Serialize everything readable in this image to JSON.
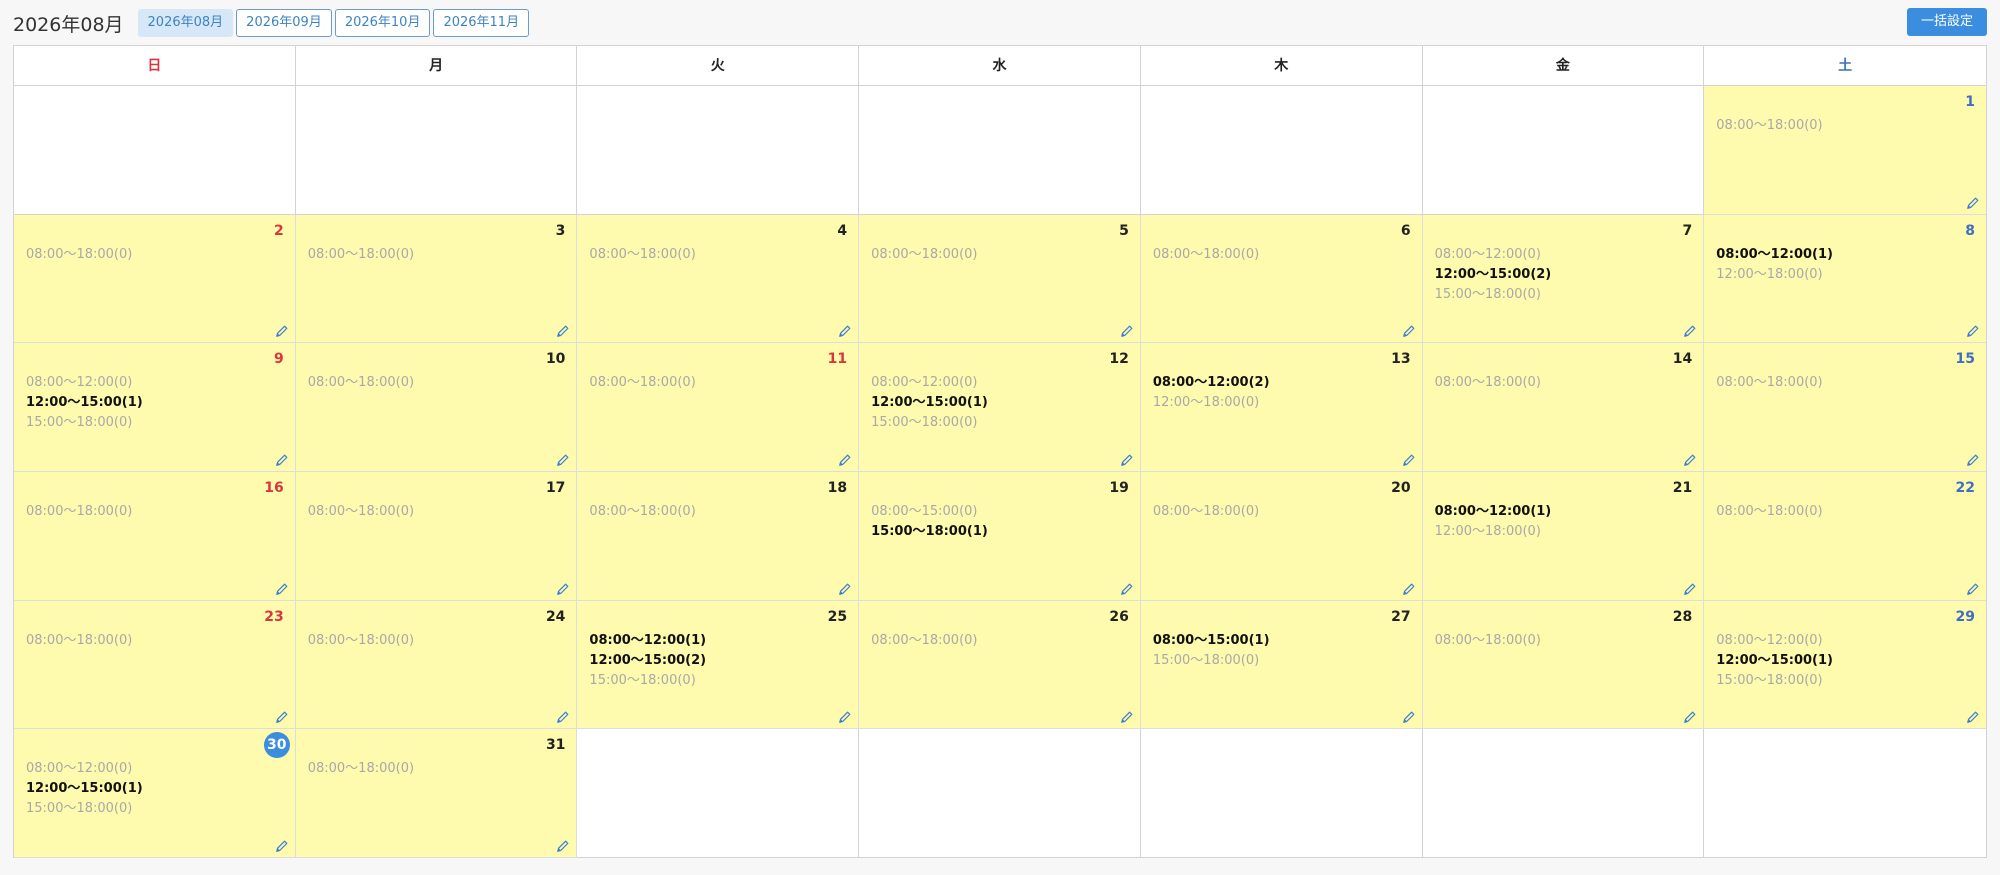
{
  "header": {
    "title": "2026年08月",
    "tabs": [
      {
        "label": "2026年08月",
        "active": true
      },
      {
        "label": "2026年09月",
        "active": false
      },
      {
        "label": "2026年10月",
        "active": false
      },
      {
        "label": "2026年11月",
        "active": false
      }
    ],
    "bulk_button": "一括設定"
  },
  "weekdays": [
    "日",
    "月",
    "火",
    "水",
    "木",
    "金",
    "土"
  ],
  "colors": {
    "sunday_holiday": "#d9363e",
    "saturday": "#3d6fc4",
    "active_day_bg": "#fffbae",
    "primary": "#3b8de0"
  },
  "icons": {
    "edit": "pencil-icon"
  },
  "days": [
    {
      "day": 1,
      "slots": [
        {
          "t": "08:00〜18:00(0)",
          "b": false
        }
      ]
    },
    {
      "day": 2,
      "slots": [
        {
          "t": "08:00〜18:00(0)",
          "b": false
        }
      ]
    },
    {
      "day": 3,
      "slots": [
        {
          "t": "08:00〜18:00(0)",
          "b": false
        }
      ]
    },
    {
      "day": 4,
      "slots": [
        {
          "t": "08:00〜18:00(0)",
          "b": false
        }
      ]
    },
    {
      "day": 5,
      "slots": [
        {
          "t": "08:00〜18:00(0)",
          "b": false
        }
      ]
    },
    {
      "day": 6,
      "slots": [
        {
          "t": "08:00〜18:00(0)",
          "b": false
        }
      ]
    },
    {
      "day": 7,
      "slots": [
        {
          "t": "08:00〜12:00(0)",
          "b": false
        },
        {
          "t": "12:00〜15:00(2)",
          "b": true
        },
        {
          "t": "15:00〜18:00(0)",
          "b": false
        }
      ]
    },
    {
      "day": 8,
      "slots": [
        {
          "t": "08:00〜12:00(1)",
          "b": true
        },
        {
          "t": "12:00〜18:00(0)",
          "b": false
        }
      ]
    },
    {
      "day": 9,
      "slots": [
        {
          "t": "08:00〜12:00(0)",
          "b": false
        },
        {
          "t": "12:00〜15:00(1)",
          "b": true
        },
        {
          "t": "15:00〜18:00(0)",
          "b": false
        }
      ]
    },
    {
      "day": 10,
      "slots": [
        {
          "t": "08:00〜18:00(0)",
          "b": false
        }
      ]
    },
    {
      "day": 11,
      "holiday": true,
      "slots": [
        {
          "t": "08:00〜18:00(0)",
          "b": false
        }
      ]
    },
    {
      "day": 12,
      "slots": [
        {
          "t": "08:00〜12:00(0)",
          "b": false
        },
        {
          "t": "12:00〜15:00(1)",
          "b": true
        },
        {
          "t": "15:00〜18:00(0)",
          "b": false
        }
      ]
    },
    {
      "day": 13,
      "slots": [
        {
          "t": "08:00〜12:00(2)",
          "b": true
        },
        {
          "t": "12:00〜18:00(0)",
          "b": false
        }
      ]
    },
    {
      "day": 14,
      "slots": [
        {
          "t": "08:00〜18:00(0)",
          "b": false
        }
      ]
    },
    {
      "day": 15,
      "slots": [
        {
          "t": "08:00〜18:00(0)",
          "b": false
        }
      ]
    },
    {
      "day": 16,
      "slots": [
        {
          "t": "08:00〜18:00(0)",
          "b": false
        }
      ]
    },
    {
      "day": 17,
      "slots": [
        {
          "t": "08:00〜18:00(0)",
          "b": false
        }
      ]
    },
    {
      "day": 18,
      "slots": [
        {
          "t": "08:00〜18:00(0)",
          "b": false
        }
      ]
    },
    {
      "day": 19,
      "slots": [
        {
          "t": "08:00〜15:00(0)",
          "b": false
        },
        {
          "t": "15:00〜18:00(1)",
          "b": true
        }
      ]
    },
    {
      "day": 20,
      "slots": [
        {
          "t": "08:00〜18:00(0)",
          "b": false
        }
      ]
    },
    {
      "day": 21,
      "slots": [
        {
          "t": "08:00〜12:00(1)",
          "b": true
        },
        {
          "t": "12:00〜18:00(0)",
          "b": false
        }
      ]
    },
    {
      "day": 22,
      "slots": [
        {
          "t": "08:00〜18:00(0)",
          "b": false
        }
      ]
    },
    {
      "day": 23,
      "slots": [
        {
          "t": "08:00〜18:00(0)",
          "b": false
        }
      ]
    },
    {
      "day": 24,
      "slots": [
        {
          "t": "08:00〜18:00(0)",
          "b": false
        }
      ]
    },
    {
      "day": 25,
      "slots": [
        {
          "t": "08:00〜12:00(1)",
          "b": true
        },
        {
          "t": "12:00〜15:00(2)",
          "b": true
        },
        {
          "t": "15:00〜18:00(0)",
          "b": false
        }
      ]
    },
    {
      "day": 26,
      "slots": [
        {
          "t": "08:00〜18:00(0)",
          "b": false
        }
      ]
    },
    {
      "day": 27,
      "slots": [
        {
          "t": "08:00〜15:00(1)",
          "b": true
        },
        {
          "t": "15:00〜18:00(0)",
          "b": false
        }
      ]
    },
    {
      "day": 28,
      "slots": [
        {
          "t": "08:00〜18:00(0)",
          "b": false
        }
      ]
    },
    {
      "day": 29,
      "slots": [
        {
          "t": "08:00〜12:00(0)",
          "b": false
        },
        {
          "t": "12:00〜15:00(1)",
          "b": true
        },
        {
          "t": "15:00〜18:00(0)",
          "b": false
        }
      ]
    },
    {
      "day": 30,
      "today": true,
      "slots": [
        {
          "t": "08:00〜12:00(0)",
          "b": false
        },
        {
          "t": "12:00〜15:00(1)",
          "b": true
        },
        {
          "t": "15:00〜18:00(0)",
          "b": false
        }
      ]
    },
    {
      "day": 31,
      "slots": [
        {
          "t": "08:00〜18:00(0)",
          "b": false
        }
      ]
    }
  ]
}
